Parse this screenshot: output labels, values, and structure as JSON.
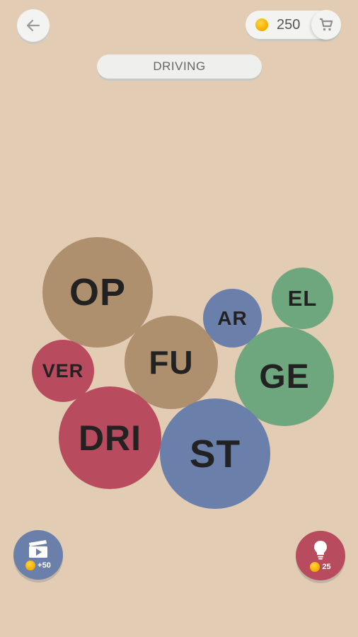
{
  "header": {
    "coins": "250",
    "category": "DRIVING"
  },
  "bubbles": [
    {
      "text": "OP",
      "color": "#ae8f6e"
    },
    {
      "text": "EL",
      "color": "#6ea67e"
    },
    {
      "text": "AR",
      "color": "#6a7fa9"
    },
    {
      "text": "FU",
      "color": "#ae8f6e"
    },
    {
      "text": "VER",
      "color": "#b84b5d"
    },
    {
      "text": "GE",
      "color": "#6ea67e"
    },
    {
      "text": "DRI",
      "color": "#b84b5d"
    },
    {
      "text": "ST",
      "color": "#6a7fa9"
    }
  ],
  "footer": {
    "video_reward": "+50",
    "hint_cost": "25"
  },
  "icons": {
    "back": "arrow-left-icon",
    "cart": "cart-icon",
    "video": "clapperboard-icon",
    "hint": "lightbulb-icon",
    "coin": "coin-icon"
  }
}
